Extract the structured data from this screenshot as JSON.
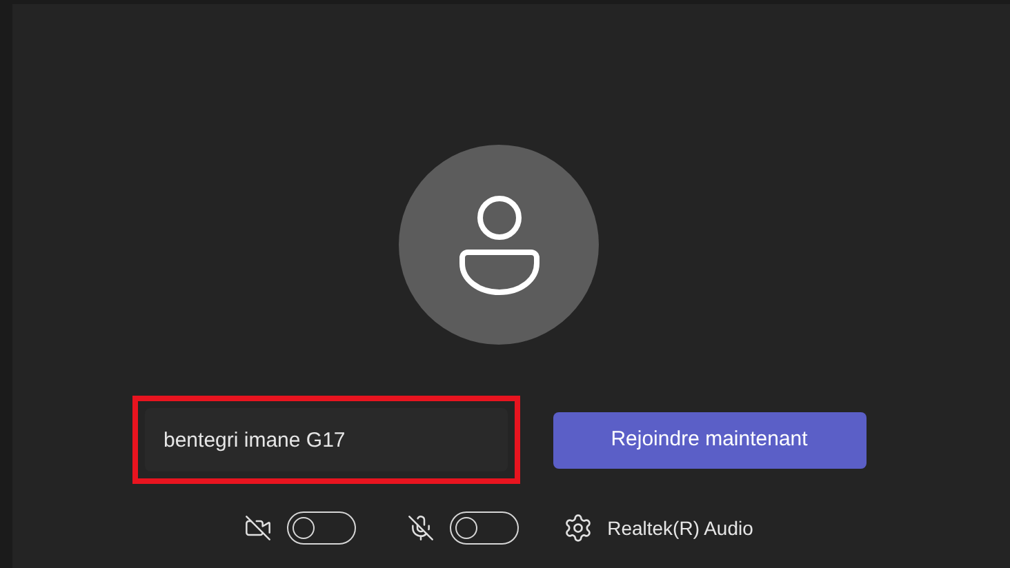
{
  "name_field": {
    "value": "bentegri imane G17",
    "highlighted": true
  },
  "join_button": {
    "label": "Rejoindre maintenant"
  },
  "controls": {
    "camera": {
      "on": false
    },
    "microphone": {
      "on": false
    },
    "audio_device": "Realtek(R) Audio"
  }
}
